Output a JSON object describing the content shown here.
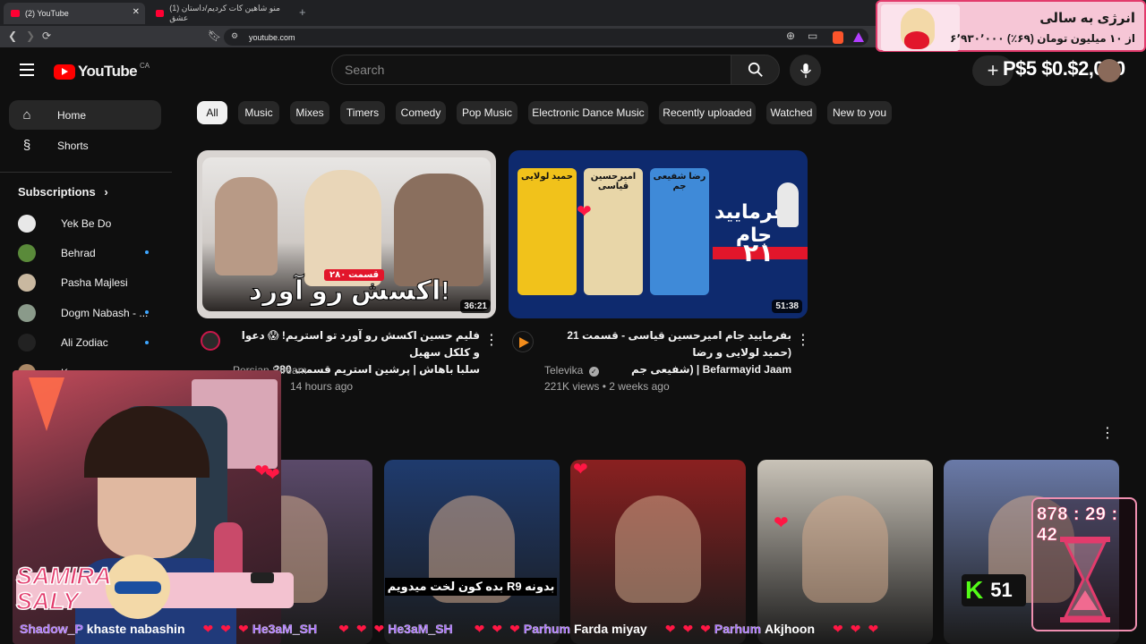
{
  "browser": {
    "tabs": [
      {
        "title": "(2) YouTube"
      },
      {
        "title": "(1) منو شاهین کات کردیم/داستان عشق"
      }
    ],
    "new_tab_icon": "plus-icon",
    "url": "youtube.com"
  },
  "masthead": {
    "logo_text": "YouTube",
    "region": "CA",
    "search_placeholder": "Search",
    "create_icon": "plus-icon"
  },
  "sidebar": {
    "items": [
      {
        "label": "Home",
        "icon": "home-icon"
      },
      {
        "label": "Shorts",
        "icon": "shorts-icon"
      }
    ],
    "subscriptions_title": "Subscriptions",
    "subscriptions": [
      {
        "name": "Yek Be Do",
        "color": "#e8e8e8",
        "new": false
      },
      {
        "name": "Behrad",
        "color": "#5a8a3a",
        "new": true
      },
      {
        "name": "Pasha Majlesi",
        "color": "#c9b8a0",
        "new": false
      },
      {
        "name": "Dogm Nabash - ...",
        "color": "#8a9a8a",
        "new": true
      },
      {
        "name": "Ali Zodiac",
        "color": "#222222",
        "new": true
      },
      {
        "name": "Kouman",
        "color": "#aa8866",
        "new": false
      }
    ]
  },
  "chips": [
    "All",
    "Music",
    "Mixes",
    "Timers",
    "Comedy",
    "Pop Music",
    "Electronic Dance Music",
    "Recently uploaded",
    "Watched",
    "New to you"
  ],
  "videos": [
    {
      "title_line1": "فلیم حسین اکسش رو آورد تو استریم! 😱 دعوا و کلکل سهیل",
      "title_line2": "سلبا باهاش | پرشین استریم قسمت 280",
      "thumb_text": "اکسش رو آورد!",
      "thumb_badge": "قسمت ۲۸۰",
      "channel": "Persian Stream",
      "meta": "14 hours ago",
      "duration": "36:21"
    },
    {
      "title_line1": "بفرمایید جام امیرحسین قیاسی - قسمت 21 (حمید لولایی و رضا",
      "title_line2": "Befarmayid Jaam | (شفیعی جم",
      "thumb_text": "بفرمایید جام",
      "thumb_number": "۲۱",
      "thumb_names": [
        "حمید لولایی",
        "امیرحسین قیاسی",
        "رضا شفیعی جم"
      ],
      "channel": "Televika",
      "verified": true,
      "meta": "221K views • 2 weeks ago",
      "duration": "51:38"
    }
  ],
  "shorts": [
    {
      "caption": "",
      "color": "#5b4a6a"
    },
    {
      "caption": "بدونه R9 بده کون لخت میدویم",
      "color": "#1f3b6e"
    },
    {
      "caption": "",
      "color": "#8a2020"
    },
    {
      "caption": "",
      "color": "#c9c3b8"
    },
    {
      "caption": "",
      "color": "#6a7aa8"
    }
  ],
  "overlay": {
    "promo_title": "انرژی به سالی",
    "promo_sub": "۶٬۹۳۰٬۰۰۰ از ۱۰ میلیون تومان (۶۹٪)",
    "money_text": "P$5 $0.$2,000",
    "streamer_name": "SAMIRA SALY",
    "timer": "878 : 29 : 42",
    "kick_label": "K",
    "kick_count": "51",
    "ticker": [
      {
        "name": "Shadow_P",
        "msg": "khaste nabashin"
      },
      {
        "name": "He3aM_SH",
        "msg": ""
      },
      {
        "name": "He3aM_SH",
        "msg": ""
      },
      {
        "name": "Parhum",
        "msg": "Farda miyay"
      },
      {
        "name": "Parhum",
        "msg": "Akjhoon"
      }
    ]
  }
}
